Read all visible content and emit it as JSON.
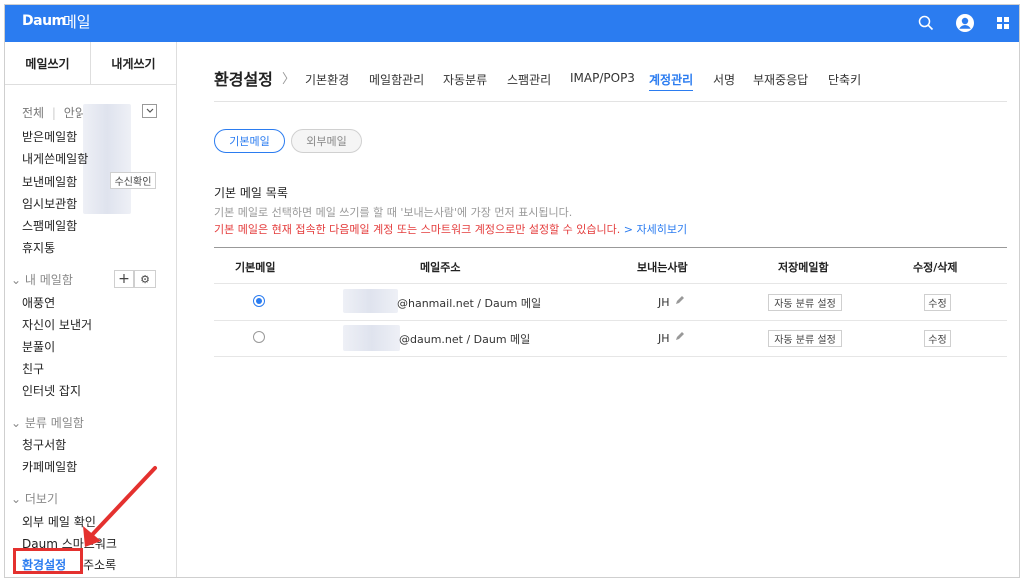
{
  "app": {
    "logo": "Daum",
    "title": "메일"
  },
  "header": {
    "icons": [
      "search-icon",
      "account-icon",
      "apps-grid-icon"
    ]
  },
  "sidebar": {
    "compose_label": "메일쓰기",
    "self_compose_label": "내게쓰기",
    "filter": {
      "all": "전체",
      "unread": "안읽"
    },
    "folders": [
      "받은메일함",
      "내게쓴메일함",
      "보낸메일함",
      "임시보관함",
      "스팸메일함",
      "휴지통"
    ],
    "receipt_check": "수신확인",
    "my_mailbox": {
      "title": "내 메일함",
      "items": [
        "애풍연",
        "자신이 보낸거",
        "분풀이",
        "친구",
        "인터넷 잡지"
      ]
    },
    "category_mailbox": {
      "title": "분류 메일함",
      "items": [
        "청구서함",
        "카페메일함"
      ]
    },
    "more": {
      "title": "더보기",
      "items": [
        "외부 메일 확인",
        "Daum 스마트워크"
      ]
    },
    "settings_label": "환경설정",
    "address_book": "주소록"
  },
  "main": {
    "breadcrumb": "환경설정",
    "tabs": [
      "기본환경",
      "메일함관리",
      "자동분류",
      "스팸관리",
      "IMAP/POP3",
      "계정관리",
      "서명",
      "부재중응답",
      "단축키"
    ],
    "active_tab": "계정관리",
    "subtabs": {
      "default_mail": "기본메일",
      "external_mail": "외부메일"
    },
    "section_title": "기본 메일 목록",
    "description": "기본 메일로 선택하면 메일 쓰기를 할 때 '보내는사람'에 가장 먼저 표시됩니다.",
    "warning": "기본 메일은 현재 접속한 다음메일 계정 또는 스마트워크 계정으로만 설정할 수 있습니다.",
    "more_link": "> 자세히보기",
    "table": {
      "headers": [
        "기본메일",
        "메일주소",
        "보내는사람",
        "저장메일함",
        "수정/삭제"
      ],
      "rows": [
        {
          "selected": true,
          "address": "@hanmail.net / Daum 메일",
          "sender": "JH",
          "mailbox_btn": "자동 분류 설정",
          "edit_btn": "수정"
        },
        {
          "selected": false,
          "address": "@daum.net / Daum 메일",
          "sender": "JH",
          "mailbox_btn": "자동 분류 설정",
          "edit_btn": "수정"
        }
      ]
    }
  },
  "colors": {
    "brand": "#2b7cf0",
    "warning": "#e43c3c",
    "annotation": "#e4312f"
  }
}
